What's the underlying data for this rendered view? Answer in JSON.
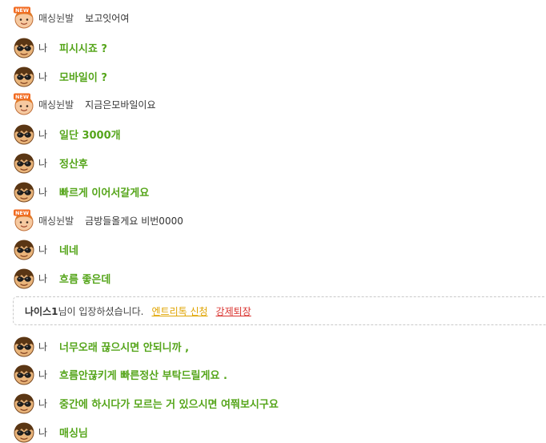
{
  "badge_text": "NEW",
  "colors": {
    "my_message": "#55a51a",
    "link_yellow": "#e0a400",
    "link_red": "#d9302c"
  },
  "messages": [
    {
      "type": "other",
      "avatar": "new-user-avatar",
      "nick": "매싱뉜발",
      "text": "보고잇어여"
    },
    {
      "type": "me",
      "avatar": "sunglasses-avatar",
      "nick": "나",
      "text": "피시시죠 ?"
    },
    {
      "type": "me",
      "avatar": "sunglasses-avatar",
      "nick": "나",
      "text": "모바일이 ?"
    },
    {
      "type": "other",
      "avatar": "new-user-avatar",
      "nick": "매싱뉜발",
      "text": "지금은모바일이요"
    },
    {
      "type": "me",
      "avatar": "sunglasses-avatar",
      "nick": "나",
      "text": "일단 3000개"
    },
    {
      "type": "me",
      "avatar": "sunglasses-avatar",
      "nick": "나",
      "text": "정산후"
    },
    {
      "type": "me",
      "avatar": "sunglasses-avatar",
      "nick": "나",
      "text": "빠르게 이어서갈게요"
    },
    {
      "type": "other",
      "avatar": "new-user-avatar",
      "nick": "매싱뉜발",
      "text": "금방들올게요 비번0000"
    },
    {
      "type": "me",
      "avatar": "sunglasses-avatar",
      "nick": "나",
      "text": "네네"
    },
    {
      "type": "me",
      "avatar": "sunglasses-avatar",
      "nick": "나",
      "text": "흐름 좋은데"
    },
    {
      "type": "me",
      "avatar": "sunglasses-avatar",
      "nick": "나",
      "text": "너무오래 끊으시면 안되니까 ,"
    },
    {
      "type": "me",
      "avatar": "sunglasses-avatar",
      "nick": "나",
      "text": "흐름안끊키게 빠른정산 부탁드릴게요 ."
    },
    {
      "type": "me",
      "avatar": "sunglasses-avatar",
      "nick": "나",
      "text": "중간에 하시다가 모르는 거 있으시면 여쭤보시구요"
    },
    {
      "type": "me",
      "avatar": "sunglasses-avatar",
      "nick": "나",
      "text": "매싱님"
    }
  ],
  "notice": {
    "user": "나이스1",
    "text": "님이 입장하셨습니다.",
    "link_1": "엔트리톡 신청",
    "link_2": "강제퇴장"
  }
}
